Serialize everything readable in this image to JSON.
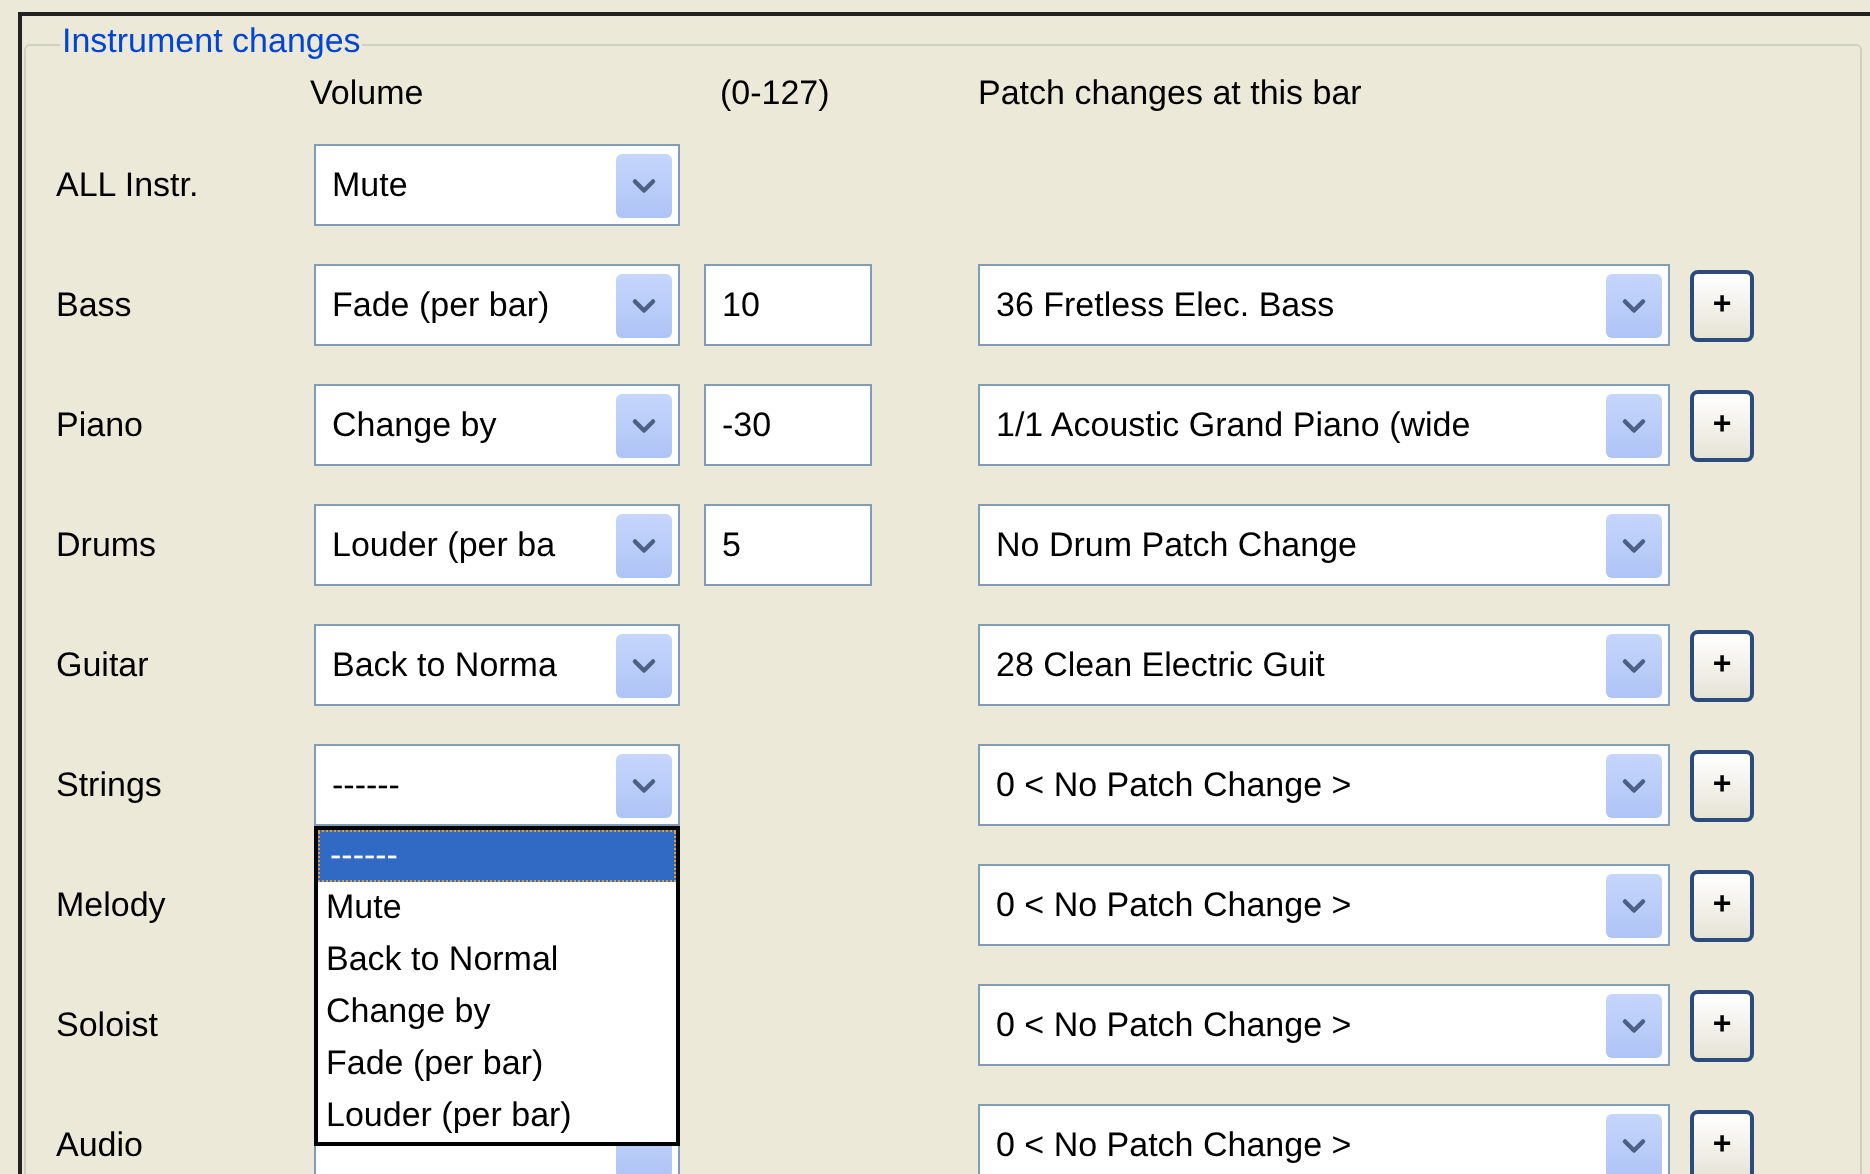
{
  "group": {
    "title": "Instrument changes"
  },
  "headers": {
    "volume": "Volume",
    "range": "(0-127)",
    "patch": "Patch changes at this bar"
  },
  "rows": [
    {
      "label": "ALL Instr.",
      "volume": {
        "value": "Mute"
      }
    },
    {
      "label": "Bass",
      "volume": {
        "value": "Fade (per bar)"
      },
      "amount": "10",
      "patch": "36 Fretless Elec. Bass",
      "plus": "+"
    },
    {
      "label": "Piano",
      "volume": {
        "value": "Change by"
      },
      "amount": "-30",
      "patch": "1/1 Acoustic Grand Piano (wide",
      "plus": "+"
    },
    {
      "label": "Drums",
      "volume": {
        "value": "Louder (per ba"
      },
      "amount": "5",
      "patch": "No Drum Patch Change"
    },
    {
      "label": "Guitar",
      "volume": {
        "value": "Back to Norma"
      },
      "patch": "28 Clean Electric Guit",
      "plus": "+"
    },
    {
      "label": "Strings",
      "volume": {
        "value": "------",
        "open": true,
        "options": [
          {
            "label": "------",
            "selected": true
          },
          {
            "label": "Mute",
            "selected": false
          },
          {
            "label": "Back to Normal",
            "selected": false
          },
          {
            "label": "Change by",
            "selected": false
          },
          {
            "label": "Fade (per bar)",
            "selected": false
          },
          {
            "label": "Louder (per bar)",
            "selected": false
          }
        ]
      },
      "patch": "0 < No Patch Change >",
      "plus": "+"
    },
    {
      "label": "Melody",
      "patch": "0 < No Patch Change >",
      "plus": "+"
    },
    {
      "label": "Soloist",
      "patch": "0 < No Patch Change >",
      "plus": "+"
    },
    {
      "label": "Audio",
      "volume": {},
      "patch": "0 < No Patch Change >",
      "plus": "+"
    }
  ]
}
